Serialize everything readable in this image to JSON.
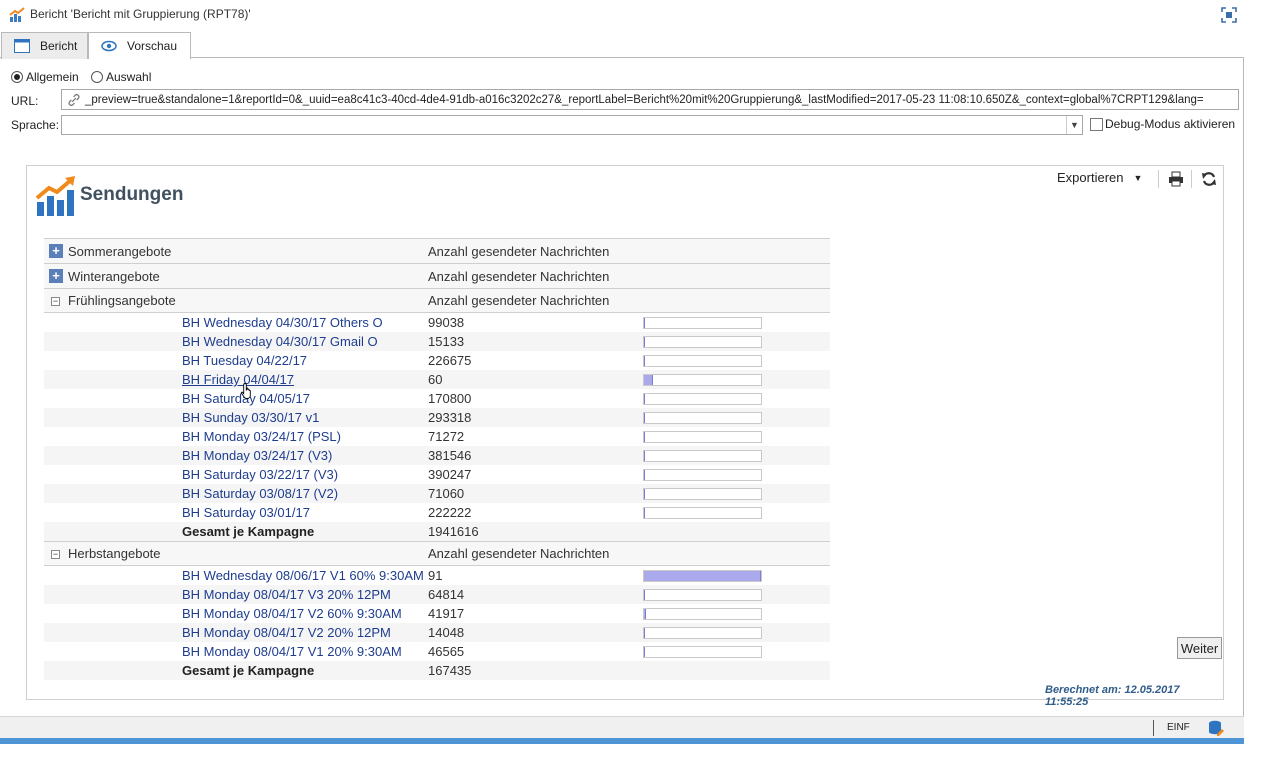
{
  "window": {
    "title": "Bericht 'Bericht mit Gruppierung (RPT78)'"
  },
  "tabs": [
    {
      "label": "Bericht",
      "icon": "report-window-icon"
    },
    {
      "label": "Vorschau",
      "icon": "eye-icon"
    }
  ],
  "mode": {
    "options": [
      {
        "label": "Allgemein",
        "selected": true
      },
      {
        "label": "Auswahl",
        "selected": false
      }
    ]
  },
  "url": {
    "label": "URL:",
    "value": "_preview=true&standalone=1&reportId=0&_uuid=ea8c41c3-40cd-4de4-91db-a016c3202c27&_reportLabel=Bericht%20mit%20Gruppierung&_lastModified=2017-05-23 11:08:10.650Z&_context=global%7CRPT129&lang="
  },
  "language": {
    "label": "Sprache:",
    "value": ""
  },
  "debug": {
    "label": "Debug-Modus aktivieren",
    "checked": false
  },
  "report": {
    "title": "Sendungen",
    "export_label": "Exportieren",
    "next_label": "Weiter",
    "computed": "Berechnet am: 12.05.2017 11:55:25",
    "groups": [
      {
        "name": "Sommerangebote",
        "column": "Anzahl gesendeter Nachrichten",
        "expanded": false,
        "rows": []
      },
      {
        "name": "Winterangebote",
        "column": "Anzahl gesendeter Nachrichten",
        "expanded": false,
        "rows": []
      },
      {
        "name": "Frühlingsangebote",
        "column": "Anzahl gesendeter Nachrichten",
        "expanded": true,
        "rows": [
          {
            "name": "BH Wednesday 04/30/17 Others O",
            "value": "99038",
            "bar": 0.01
          },
          {
            "name": "BH Wednesday 04/30/17 Gmail O",
            "value": "15133",
            "bar": 0.01
          },
          {
            "name": "BH Tuesday 04/22/17",
            "value": "226675",
            "bar": 0.01
          },
          {
            "name": "BH Friday 04/04/17",
            "value": "60",
            "bar": 0.08
          },
          {
            "name": "BH Saturday 04/05/17",
            "value": "170800",
            "bar": 0.01
          },
          {
            "name": "BH Sunday 03/30/17 v1",
            "value": "293318",
            "bar": 0.01
          },
          {
            "name": "BH Monday 03/24/17 (PSL)",
            "value": "71272",
            "bar": 0.01
          },
          {
            "name": "BH Monday 03/24/17 (V3)",
            "value": "381546",
            "bar": 0.01
          },
          {
            "name": "BH Saturday 03/22/17 (V3)",
            "value": "390247",
            "bar": 0.01
          },
          {
            "name": "BH Saturday 03/08/17 (V2)",
            "value": "71060",
            "bar": 0.01
          },
          {
            "name": "BH Saturday 03/01/17",
            "value": "222222",
            "bar": 0.01
          }
        ],
        "total_label": "Gesamt je Kampagne",
        "total": "1941616"
      },
      {
        "name": "Herbstangebote",
        "column": "Anzahl gesendeter Nachrichten",
        "expanded": true,
        "rows": [
          {
            "name": "BH Wednesday 08/06/17 V1 60% 9:30AM",
            "value": "91",
            "bar": 1.0
          },
          {
            "name": "BH Monday 08/04/17 V3 20% 12PM",
            "value": "64814",
            "bar": 0.01
          },
          {
            "name": "BH Monday 08/04/17 V2 60% 9:30AM",
            "value": "41917",
            "bar": 0.02
          },
          {
            "name": "BH Monday 08/04/17 V2 20% 12PM",
            "value": "14048",
            "bar": 0.01
          },
          {
            "name": "BH Monday 08/04/17 V1 20% 9:30AM",
            "value": "46565",
            "bar": 0.01
          }
        ],
        "total_label": "Gesamt je Kampagne",
        "total": "167435"
      }
    ]
  },
  "statusbar": {
    "mode": "EINF"
  },
  "colors": {
    "link": "#1e3d8f",
    "bar_fill": "#a9a9ec",
    "accent": "#4f95d6"
  }
}
